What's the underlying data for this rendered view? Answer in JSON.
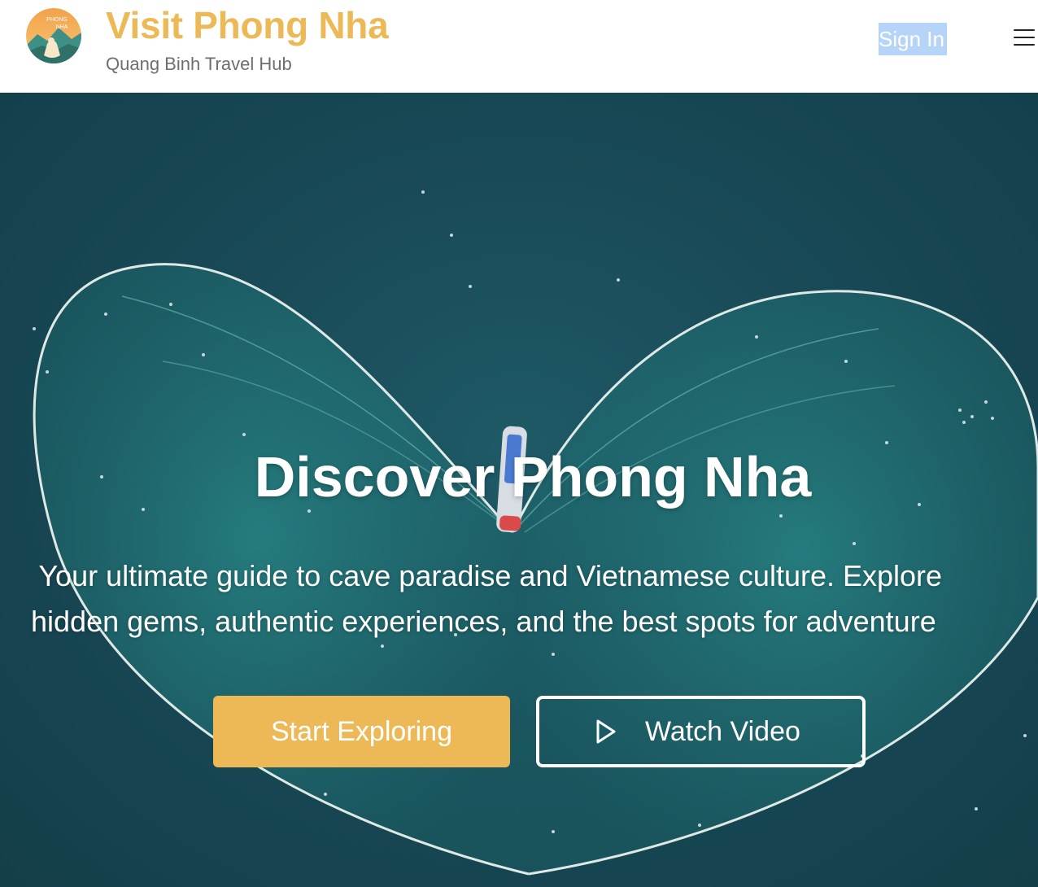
{
  "header": {
    "logo_text": [
      "PHONG",
      "NHA"
    ],
    "title": "Visit Phong Nha",
    "subtitle": "Quang Binh Travel Hub",
    "sign_in_label": "Sign In",
    "menu_icon": "hamburger-menu-icon"
  },
  "hero": {
    "title": "Discover Phong Nha",
    "description_lines": [
      " Your ultimate guide to cave paradise and Vietnamese culture. Explore",
      "hidden gems, authentic experiences, and the best spots for adventure"
    ],
    "primary_button_label": "Start Exploring",
    "secondary_button_label": "Watch Video",
    "secondary_button_icon": "play-icon"
  },
  "colors": {
    "brand": "#ecb956",
    "subtitle": "#6e6e6e",
    "hero_bg": "#194a57",
    "net_line": "#e9f2ee",
    "sign_in_highlight": "#b5d4f8"
  }
}
